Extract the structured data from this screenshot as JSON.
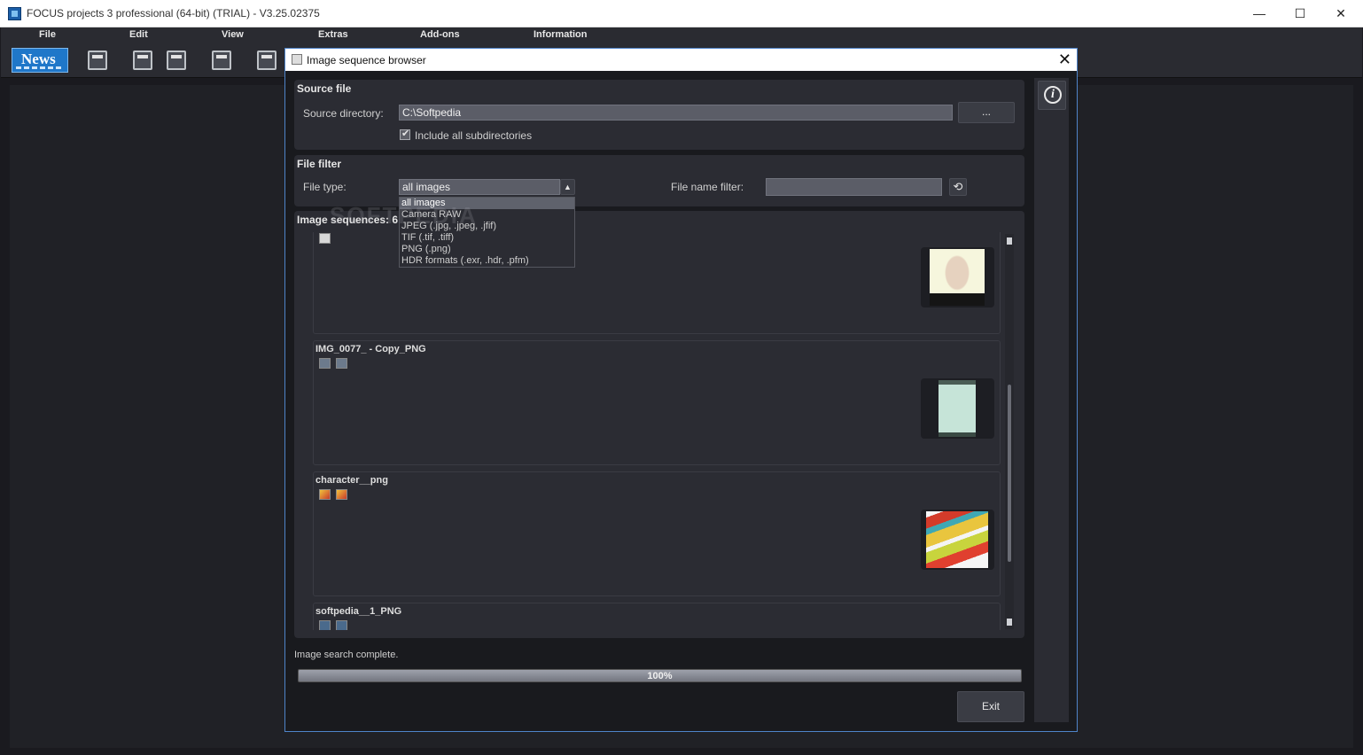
{
  "window": {
    "title": "FOCUS projects 3 professional (64-bit) (TRIAL) - V3.25.02375",
    "min_glyph": "—",
    "max_glyph": "☐",
    "close_glyph": "✕"
  },
  "menu": [
    "File",
    "Edit",
    "View",
    "Extras",
    "Add-ons",
    "Information"
  ],
  "toolbar": {
    "news_label": "News",
    "icons": [
      "news-icon",
      "preview-icon",
      "print-icon",
      "film-icon",
      "copy-icon",
      "clapper-icon"
    ]
  },
  "dialog": {
    "title": "Image sequence browser",
    "close_glyph": "✕",
    "source": {
      "header": "Source file",
      "dir_label": "Source directory:",
      "dir_value": "C:\\Softpedia",
      "browse_label": "...",
      "include_sub_label": "Include all subdirectories",
      "include_sub_checked": true
    },
    "filter": {
      "header": "File filter",
      "type_label": "File type:",
      "type_value": "all images",
      "type_options": [
        "all images",
        "Camera RAW",
        "JPEG (.jpg, .jpeg, .jfif)",
        "TIF (.tif, .tiff)",
        "PNG (.png)",
        "HDR formats (.exr, .hdr, .pfm)"
      ],
      "name_label": "File name filter:",
      "name_value": ""
    },
    "sequences": {
      "header": "Image sequences: 6",
      "items": [
        {
          "name": "",
          "thumb": "face-thumbnail"
        },
        {
          "name": "IMG_0077_ - Copy_PNG",
          "thumb": "phone-screen-thumbnail"
        },
        {
          "name": "character__png",
          "thumb": "character-thumbnail"
        },
        {
          "name": "softpedia__1_PNG",
          "thumb": ""
        }
      ]
    },
    "watermark": "SOFTPEDIA",
    "status": "Image search complete.",
    "progress": {
      "percent": 100,
      "label": "100%"
    },
    "exit_label": "Exit",
    "info_glyph": "i"
  },
  "colors": {
    "accent": "#4f84c9",
    "news_blue": "#1f77c9",
    "panel": "#2b2c33",
    "background": "#191a1e"
  }
}
